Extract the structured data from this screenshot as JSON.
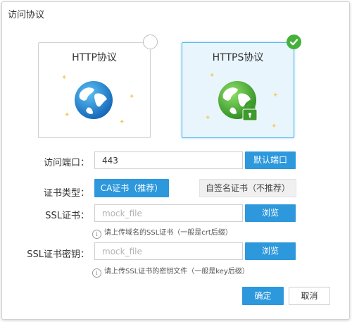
{
  "dialog": {
    "title": "访问协议"
  },
  "protocols": {
    "http": {
      "label": "HTTP协议",
      "selected": false
    },
    "https": {
      "label": "HTTPS协议",
      "selected": true
    }
  },
  "form": {
    "port": {
      "label": "访问端口：",
      "value": "443",
      "default_button": "默认端口"
    },
    "cert_type": {
      "label": "证书类型：",
      "options": [
        "CA证书（推荐）",
        "自签名证书（不推荐）"
      ],
      "selected": "CA证书（推荐）"
    },
    "ssl_cert": {
      "label": "SSL证书：",
      "placeholder": "mock_file",
      "browse_button": "浏览",
      "hint": "请上传域名的SSL证书（一般是crt后缀）"
    },
    "ssl_key": {
      "label": "SSL证书密钥：",
      "placeholder": "mock_file",
      "browse_button": "浏览",
      "hint": "请上传SSL证书的密钥文件（一般是key后缀）"
    }
  },
  "footer": {
    "confirm": "确定",
    "cancel": "取消"
  },
  "colors": {
    "accent_blue": "#2d98dc",
    "selected_card_border": "#56b6e8",
    "selected_card_bg": "#e8f5fc",
    "check_green": "#46b13a",
    "globe_blue": "#1f7fd1",
    "globe_green": "#52b43b"
  },
  "icons": {
    "http_globe": "globe-icon",
    "https_globe": "secure-globe-icon",
    "lock": "lock-icon",
    "check": "check-icon",
    "info": "info-icon"
  }
}
